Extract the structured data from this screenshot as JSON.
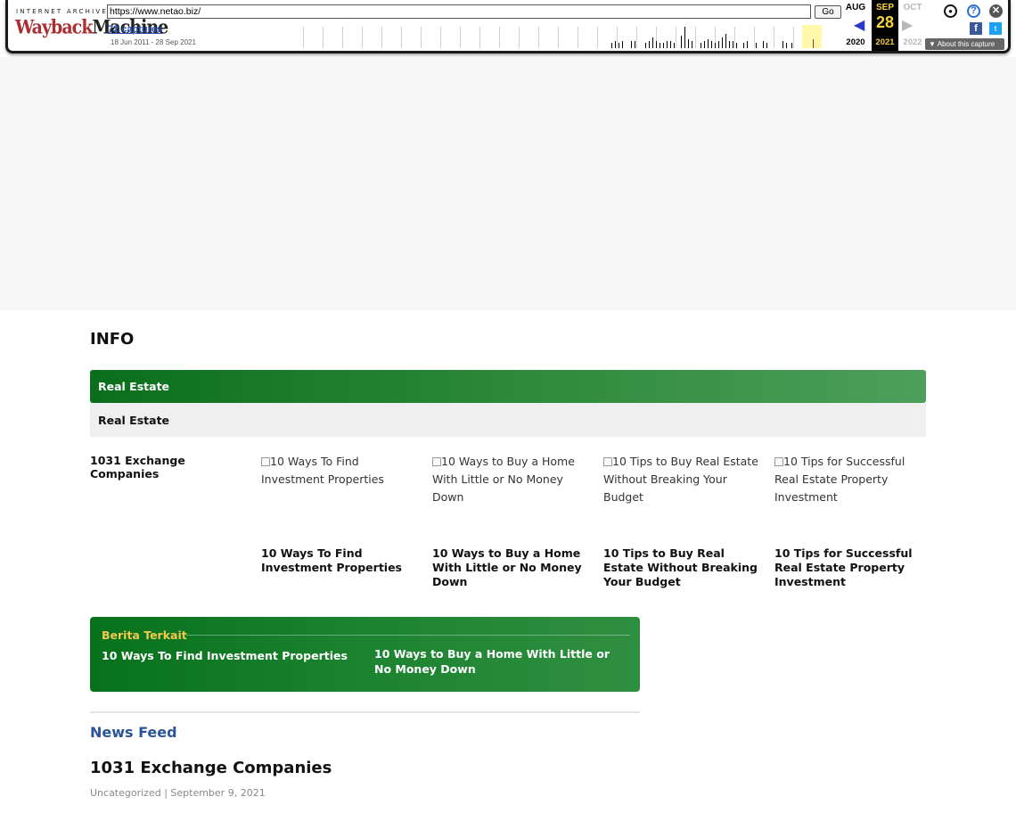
{
  "wayback": {
    "logo_top": "INTERNET ARCHIVE",
    "logo_wayback": "Wayback",
    "logo_machine": "Machine",
    "url": "https://www.netao.biz/",
    "go_label": "Go",
    "captures_label": "72 captures",
    "date_range": "18 Jun 2011 - 28 Sep 2021",
    "prev_month": "AUG",
    "cur_month": "SEP",
    "next_month": "OCT",
    "cur_day": "28",
    "prev_year": "2020",
    "cur_year": "2021",
    "next_year": "2022",
    "about_label": "About this capture",
    "icons": {
      "user": "account-icon",
      "help": "help-icon",
      "close": "close-icon",
      "facebook": "facebook-icon",
      "twitter": "twitter-icon"
    },
    "colors": {
      "wayback_red": "#ab2e33",
      "link_blue": "#2a4fb8",
      "highlight": "#fff8a8"
    }
  },
  "main": {
    "info_title": "INFO",
    "category_header": "Real Estate",
    "category_tab": "Real Estate",
    "first_post_title": "1031 Exchange Companies",
    "posts": [
      {
        "image_alt": "10 Ways To Find Investment Properties",
        "title": "10 Ways To Find Investment Properties"
      },
      {
        "image_alt": "10 Ways to Buy a Home With Little or No Money Down",
        "title": "10 Ways to Buy a Home With Little or No Money Down"
      },
      {
        "image_alt": "10 Tips to Buy Real Estate Without Breaking Your Budget",
        "title": "10 Tips to Buy Real Estate Without Breaking Your Budget"
      },
      {
        "image_alt": "10 Tips for Successful Real Estate Property Investment",
        "title": "10 Tips for Successful Real Estate Property Investment"
      }
    ],
    "related": {
      "title": "Berita Terkait",
      "links": [
        "10 Ways To Find Investment Properties",
        "10 Ways to Buy a Home With Little or No Money Down"
      ]
    },
    "news_feed": {
      "title": "News Feed",
      "post_title": "1031 Exchange Companies",
      "post_meta": "Uncategorized | September 9, 2021"
    },
    "colors": {
      "green_dark": "#0a6e1d",
      "green_light": "#4d9f5b",
      "related_title": "#f2c94c",
      "news_feed_blue": "#2a5599"
    }
  }
}
